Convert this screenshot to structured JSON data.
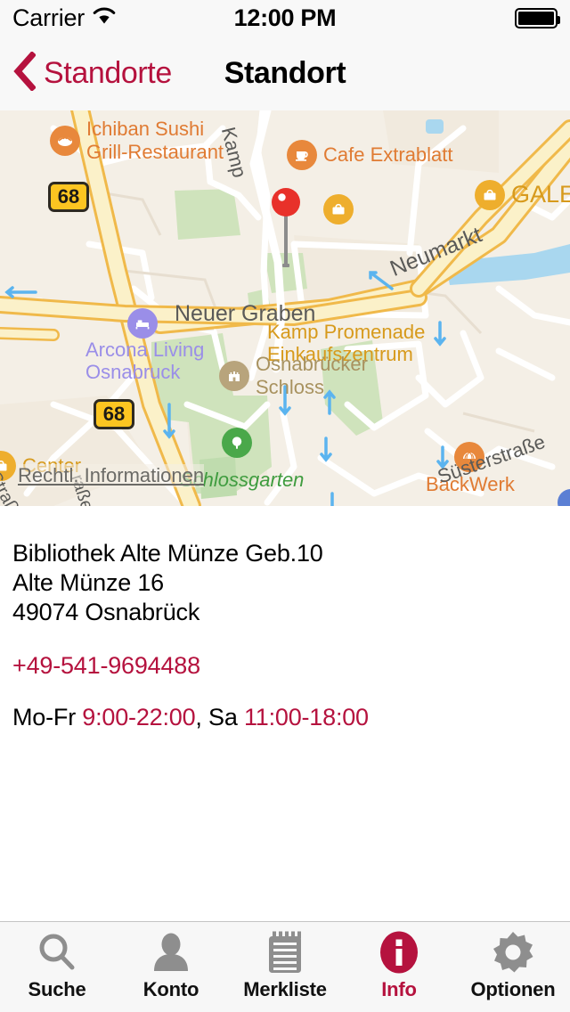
{
  "status_bar": {
    "carrier": "Carrier",
    "wifi_icon": "wifi-icon",
    "time": "12:00 PM",
    "battery_icon": "battery-full-icon"
  },
  "nav_bar": {
    "back_icon": "chevron-left-icon",
    "back_label": "Standorte",
    "title": "Standort"
  },
  "map": {
    "legal_link": "Rechtl. Informationen",
    "pin_icon": "map-pin-icon",
    "pois": [
      {
        "name": "Ichiban Sushi\nGrill-Restaurant",
        "icon": "restaurant-icon",
        "color": "#e8883c"
      },
      {
        "name": "Cafe Extrablatt",
        "icon": "cafe-icon",
        "color": "#e8883c"
      },
      {
        "name": "GALERIA",
        "icon": "shopping-bag-icon",
        "color": "#eeae2d"
      },
      {
        "name": "Kamp Promenade\nEinkaufszentrum",
        "icon": "shopping-bag-icon",
        "color": "#eeae2d"
      },
      {
        "name": "Arcona Living\nOsnabruck",
        "icon": "hotel-bed-icon",
        "color": "#9a8ee8"
      },
      {
        "name": "Osnabrücker\nSchloss",
        "icon": "castle-icon",
        "color": "#b8a47c"
      },
      {
        "name": "BackWerk",
        "icon": "bakery-icon",
        "color": "#e8883c"
      },
      {
        "name": "Schlossgarten",
        "icon": "park-tree-icon",
        "color": "#4aa84a"
      },
      {
        "name": "Center",
        "icon": "shopping-bag-icon",
        "color": "#eeae2d"
      }
    ],
    "road_labels": [
      "Kamp",
      "Neumarkt",
      "Neuer Graben",
      "Süsterstraße",
      "Straße",
      "raße"
    ],
    "route_shields": [
      "68",
      "68"
    ]
  },
  "detail": {
    "address_lines": [
      "Bibliothek Alte Münze Geb.10",
      "Alte Münze 16",
      "49074 Osnabrück"
    ],
    "phone": "+49-541-9694488",
    "hours": {
      "weekday_label": "Mo-Fr",
      "weekday_time": "9:00-22:00",
      "separator": ", ",
      "saturday_label": "Sa",
      "saturday_time": "11:00-18:00"
    }
  },
  "tab_bar": {
    "items": [
      {
        "label": "Suche",
        "icon": "search-icon",
        "active": false
      },
      {
        "label": "Konto",
        "icon": "person-icon",
        "active": false
      },
      {
        "label": "Merkliste",
        "icon": "notepad-icon",
        "active": false
      },
      {
        "label": "Info",
        "icon": "info-circle-icon",
        "active": true
      },
      {
        "label": "Optionen",
        "icon": "gear-icon",
        "active": false
      }
    ]
  },
  "colors": {
    "accent": "#b5123e",
    "map_bg": "#f4efe6",
    "tab_inactive": "#8e8e8e",
    "nav_bg": "#f8f8f8"
  }
}
